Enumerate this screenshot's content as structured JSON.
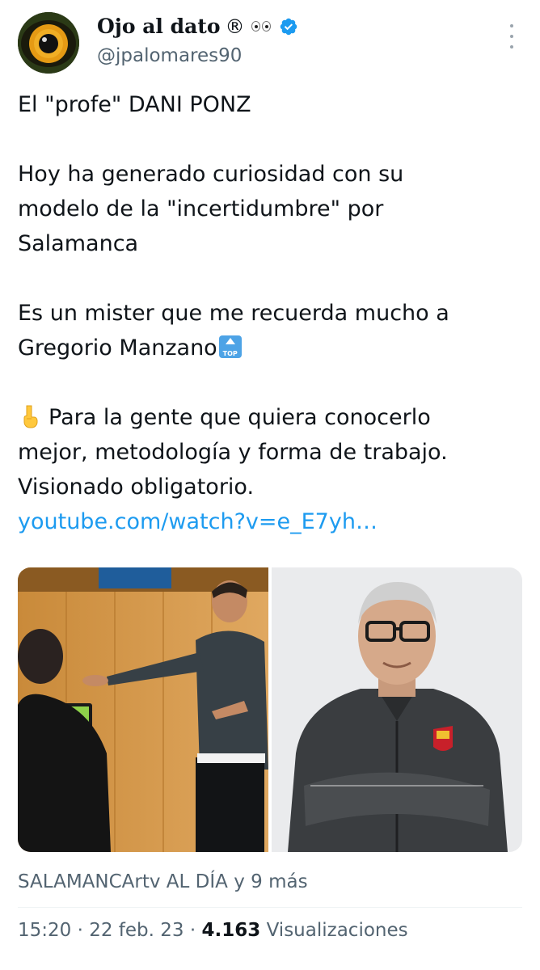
{
  "author": {
    "display_name": "Ojo al dato",
    "registered_mark": "®",
    "handle": "@jpalomares90",
    "verified": true,
    "avatar_icon": "eye-avatar",
    "accent_color": "#1d9bf0"
  },
  "tweet": {
    "lines": {
      "l1": "El \"profe\" DANI PONZ",
      "l2": "Hoy ha generado curiosidad con su",
      "l3": "modelo de la \"incertidumbre\" por",
      "l4": "Salamanca",
      "l5": "Es un mister que me recuerda mucho a",
      "l6": "Gregorio Manzano",
      "l7": "Para la gente que quiera conocerlo",
      "l8": "mejor, metodología y forma de trabajo.",
      "l9": "Visionado obligatorio."
    },
    "link": "youtube.com/watch?v=e_E7yh…",
    "emojis": [
      "top-arrow-icon",
      "pointing-down-hand-icon"
    ]
  },
  "media": {
    "count": 2,
    "photos": [
      "coach-presenting-photo",
      "coach-portrait-photo"
    ]
  },
  "footer": {
    "tagged": "SALAMANCArtv AL DÍA y 9 más",
    "time": "15:20",
    "date": "22 feb. 23",
    "separator": "·",
    "views_count": "4.163",
    "views_label": "Visualizaciones"
  }
}
